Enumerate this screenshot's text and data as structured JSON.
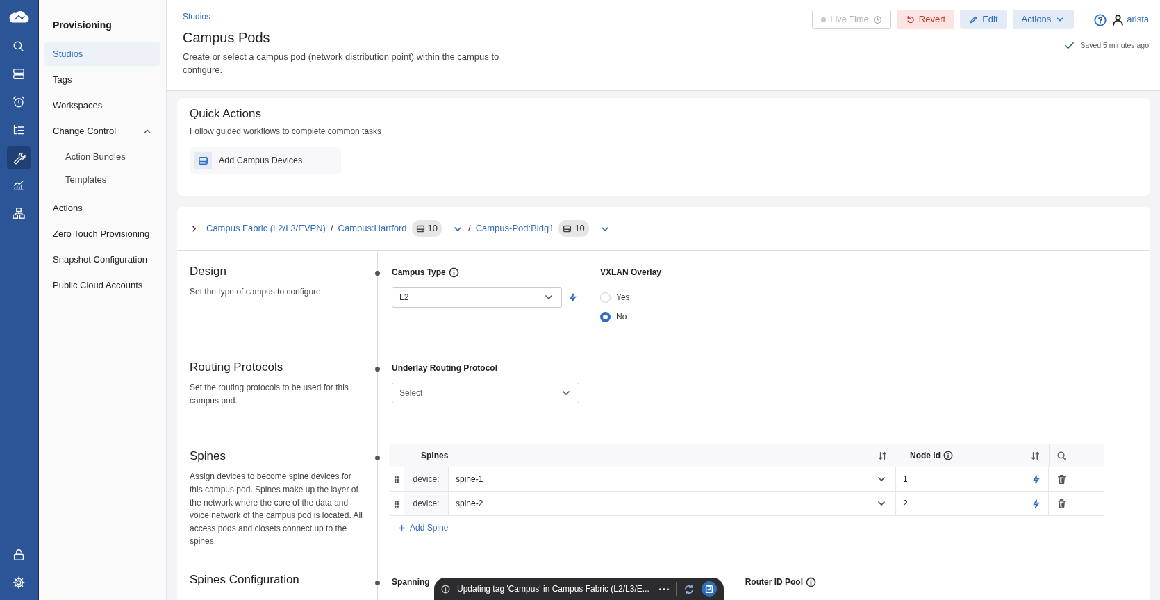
{
  "rail": {
    "top": [
      {
        "kind": "logo",
        "selected": false
      },
      {
        "kind": "search",
        "selected": false
      },
      {
        "kind": "server",
        "selected": false
      },
      {
        "kind": "alarm",
        "selected": false
      },
      {
        "kind": "list",
        "selected": false
      },
      {
        "kind": "wrench",
        "selected": true
      },
      {
        "kind": "chart",
        "selected": false
      },
      {
        "kind": "network",
        "selected": false
      }
    ],
    "bottom": [
      {
        "kind": "unlock",
        "selected": false
      },
      {
        "kind": "gear",
        "selected": false
      }
    ]
  },
  "sidebar": {
    "title": "Provisioning",
    "items": [
      {
        "label": "Studios",
        "selected": true
      },
      {
        "label": "Tags",
        "selected": false
      },
      {
        "label": "Workspaces",
        "selected": false
      },
      {
        "label": "Change Control",
        "selected": false,
        "expanded": true,
        "children": [
          {
            "label": "Action Bundles",
            "selected": false
          },
          {
            "label": "Templates",
            "selected": false
          }
        ]
      },
      {
        "label": "Actions",
        "selected": false
      },
      {
        "label": "Zero Touch Provisioning",
        "selected": false
      },
      {
        "label": "Snapshot Configuration",
        "selected": false
      },
      {
        "label": "Public Cloud Accounts",
        "selected": false
      }
    ]
  },
  "header": {
    "breadcrumb": "Studios",
    "title": "Campus Pods",
    "description": "Create or select a campus pod (network distribution point) within the campus to configure.",
    "buttons": [
      {
        "kind": "live",
        "label": "Live Time",
        "disabled": true
      },
      {
        "kind": "revert",
        "label": "Revert",
        "disabled": false
      },
      {
        "kind": "edit",
        "label": "Edit",
        "disabled": false
      },
      {
        "kind": "menu",
        "label": "Actions",
        "disabled": false
      }
    ],
    "user": "arista",
    "saved": "Saved 5 minutes ago"
  },
  "quick_actions": {
    "title": "Quick Actions",
    "subtitle": "Follow guided workflows to complete common tasks",
    "actions": [
      {
        "label": "Add Campus Devices"
      }
    ]
  },
  "path": [
    {
      "label": "Campus Fabric (L2/L3/EVPN)"
    },
    {
      "separator": "/",
      "label": "Campus:Hartford",
      "count": "10"
    },
    {
      "separator": "/",
      "label": "Campus-Pod:Bldg1",
      "count": "10"
    }
  ],
  "sections": [
    {
      "title": "Design",
      "description": "Set the type of campus to configure.",
      "fields": [
        {
          "kind": "select",
          "label": "Campus Type",
          "info": true,
          "value": "L2",
          "action": true,
          "wide": false
        },
        {
          "kind": "radio",
          "label": "VXLAN Overlay",
          "options": [
            {
              "label": "Yes",
              "selected": false
            },
            {
              "label": "No",
              "selected": true
            }
          ]
        }
      ]
    },
    {
      "title": "Routing Protocols",
      "description": "Set the routing protocols to be used for this campus pod.",
      "fields": [
        {
          "kind": "select",
          "label": "Underlay Routing Protocol",
          "info": false,
          "placeholder": "Select",
          "action": false,
          "wide": true
        }
      ]
    },
    {
      "title": "Spines",
      "description": "Assign devices to become spine devices for this campus pod. Spines make up the layer of the network where the core of the data and voice network of the campus pod is located. All access pods and closets connect up to the spines.",
      "fields": [
        {
          "kind": "table",
          "columns": [
            {
              "label": "Spines",
              "info": false
            },
            {
              "label": "Node Id",
              "info": true
            }
          ],
          "rows": [
            {
              "prefix": "device:",
              "device": "spine-1",
              "node_id": "1"
            },
            {
              "prefix": "device:",
              "device": "spine-2",
              "node_id": "2"
            }
          ],
          "add_label": "Add Spine"
        }
      ]
    },
    {
      "title": "Spines Configuration",
      "fields": [
        {
          "kind": "label",
          "label": "Spanning",
          "info": false
        },
        {
          "kind": "label",
          "label": "Router ID Pool",
          "info": true
        }
      ]
    }
  ],
  "toast": {
    "text": "Updating tag 'Campus' in Campus Fabric (L2/L3/E..."
  }
}
